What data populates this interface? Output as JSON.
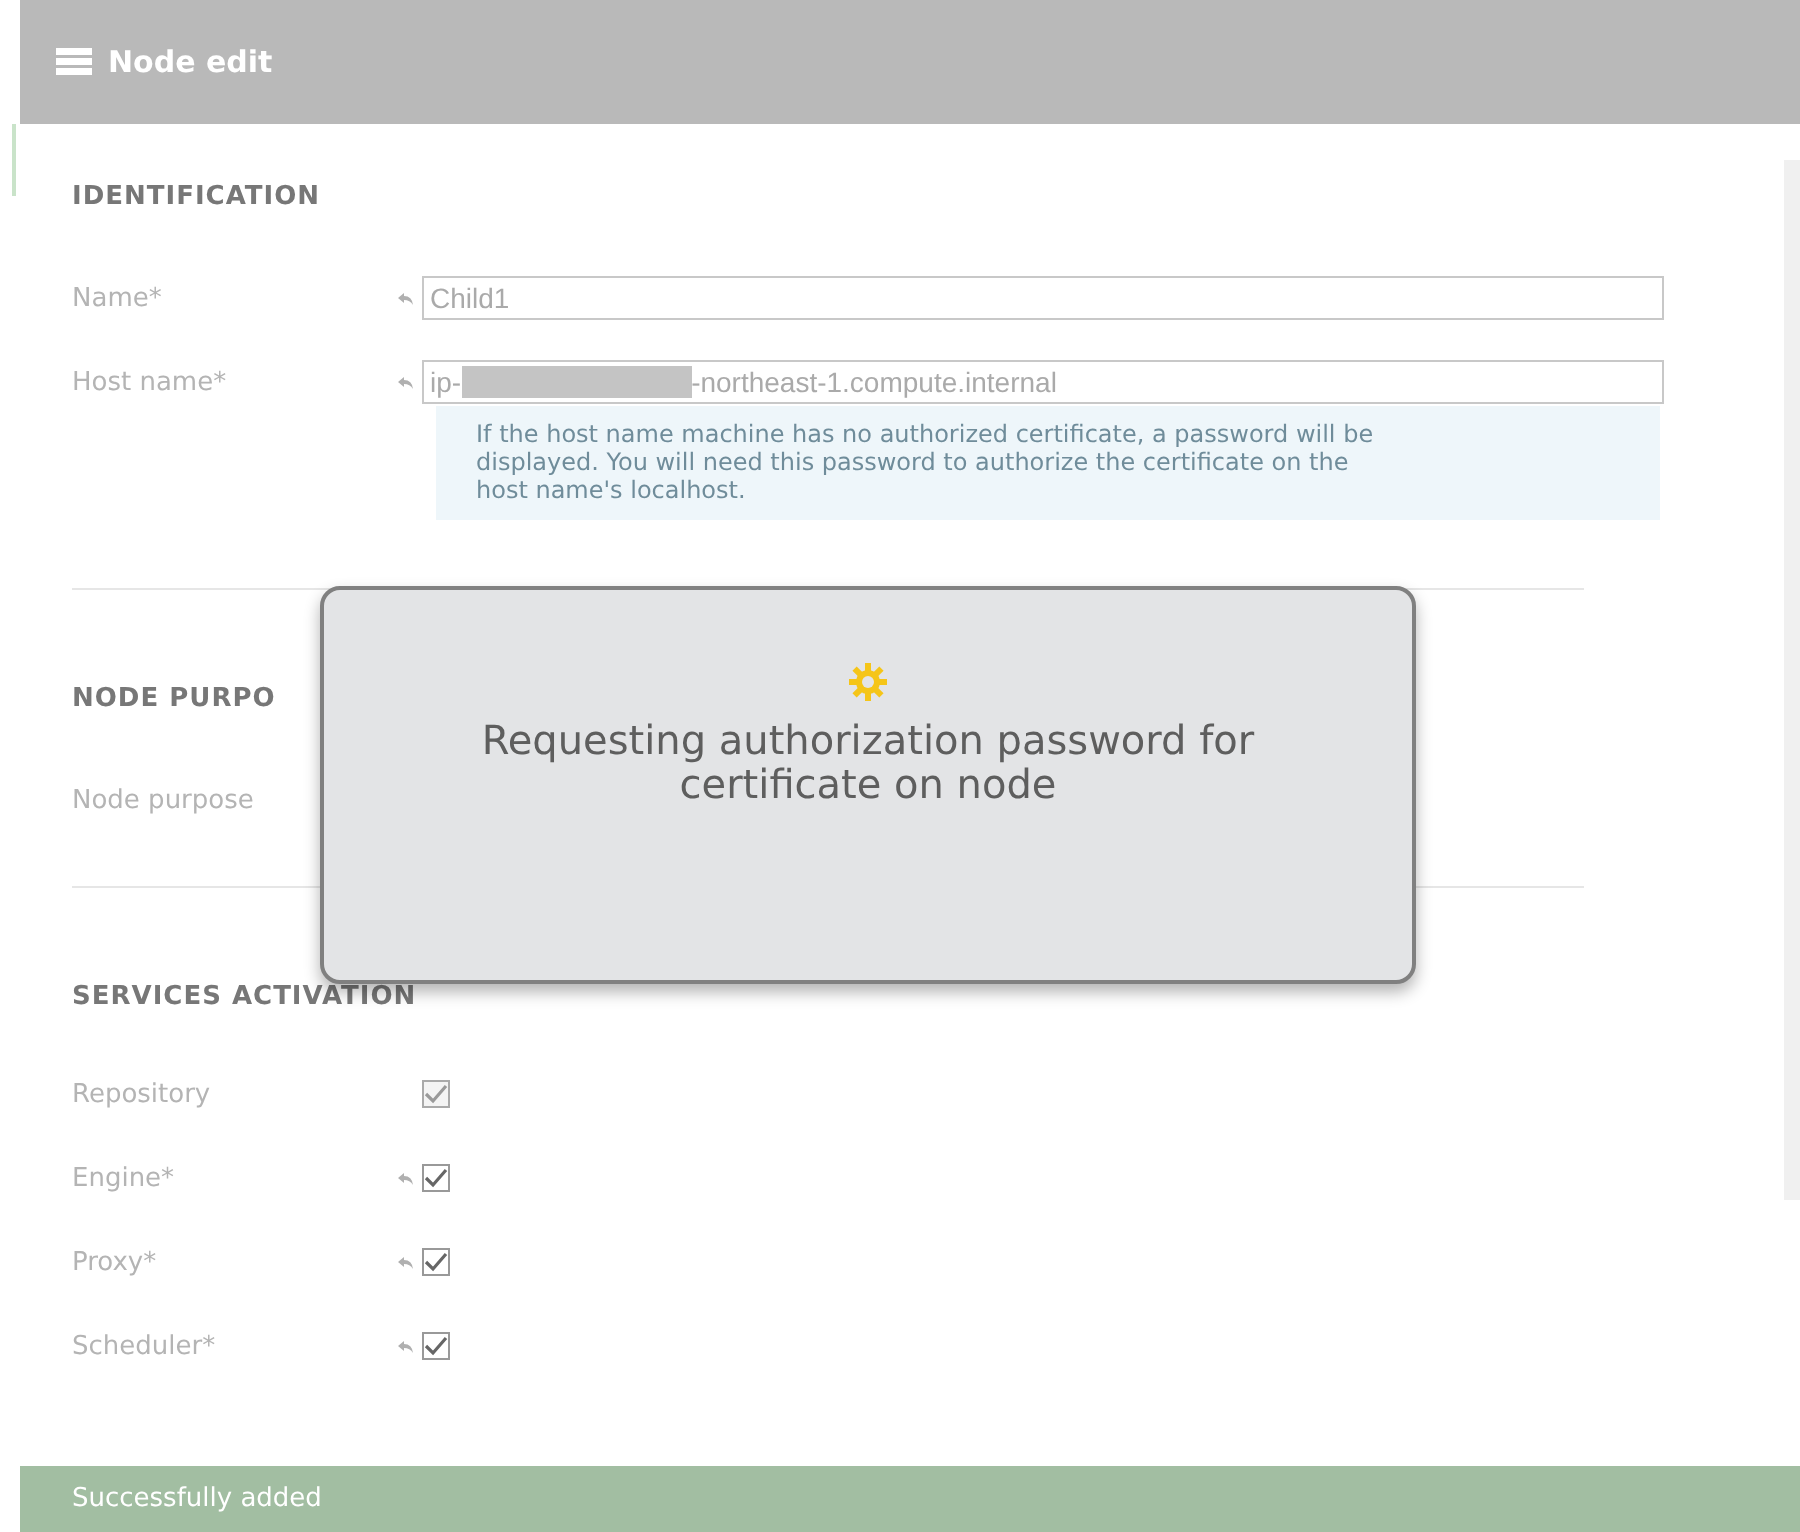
{
  "header": {
    "title": "Node edit"
  },
  "identification": {
    "heading": "IDENTIFICATION",
    "fields": [
      {
        "label": "Name*",
        "revertible": true,
        "value_parts": [
          "Child1"
        ]
      },
      {
        "label": "Host name*",
        "revertible": true,
        "value_parts": [
          "ip-",
          "-northeast-1.compute.internal"
        ],
        "redacted": true
      }
    ],
    "info": "If the host name machine has no authorized certificate, a password will be displayed. You will need this password to authorize the certificate on the host name's localhost."
  },
  "node_purpose": {
    "heading": "NODE PURPO",
    "label": "Node purpose"
  },
  "services": {
    "heading": "SERVICES ACTIVATION",
    "items": [
      {
        "label": "Repository",
        "revertible": false,
        "checked": true,
        "disabled": true
      },
      {
        "label": "Engine*",
        "revertible": true,
        "checked": true,
        "disabled": false
      },
      {
        "label": "Proxy*",
        "revertible": true,
        "checked": true,
        "disabled": false
      },
      {
        "label": "Scheduler*",
        "revertible": true,
        "checked": true,
        "disabled": false
      }
    ]
  },
  "dialog": {
    "message": "Requesting authorization password for certificate on node"
  },
  "toast": {
    "message": "Successfully added"
  }
}
